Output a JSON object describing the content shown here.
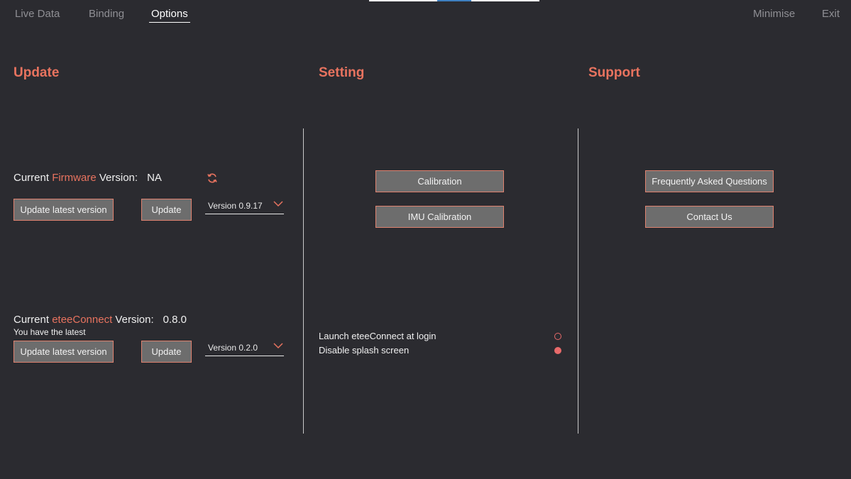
{
  "nav": {
    "tabs": [
      {
        "label": "Live Data",
        "active": false
      },
      {
        "label": "Binding",
        "active": false
      },
      {
        "label": "Options",
        "active": true
      }
    ],
    "minimise_label": "Minimise",
    "exit_label": "Exit"
  },
  "update": {
    "title": "Update",
    "firmware": {
      "prefix": "Current ",
      "name": "Firmware",
      "suffix": " Version:",
      "value": "NA",
      "refresh_icon": "refresh-icon",
      "update_latest_label": "Update latest version",
      "update_label": "Update",
      "selected_version": "Version 0.9.17"
    },
    "eteeconnect": {
      "prefix": "Current ",
      "name": "eteeConnect",
      "suffix": " Version:",
      "value": "0.8.0",
      "note": "You have the latest",
      "update_latest_label": "Update latest version",
      "update_label": "Update",
      "selected_version": "Version 0.2.0"
    }
  },
  "setting": {
    "title": "Setting",
    "calibration_label": "Calibration",
    "imu_calibration_label": "IMU Calibration",
    "options": [
      {
        "label": "Launch eteeConnect at login",
        "enabled": false
      },
      {
        "label": "Disable splash screen",
        "enabled": true
      }
    ]
  },
  "support": {
    "title": "Support",
    "faq_label": "Frequently Asked Questions",
    "contact_label": "Contact Us"
  },
  "colors": {
    "accent": "#e8735f",
    "background": "#2b2b30",
    "button_fill": "#6d6d6d",
    "toggle": "#e86a6a"
  }
}
